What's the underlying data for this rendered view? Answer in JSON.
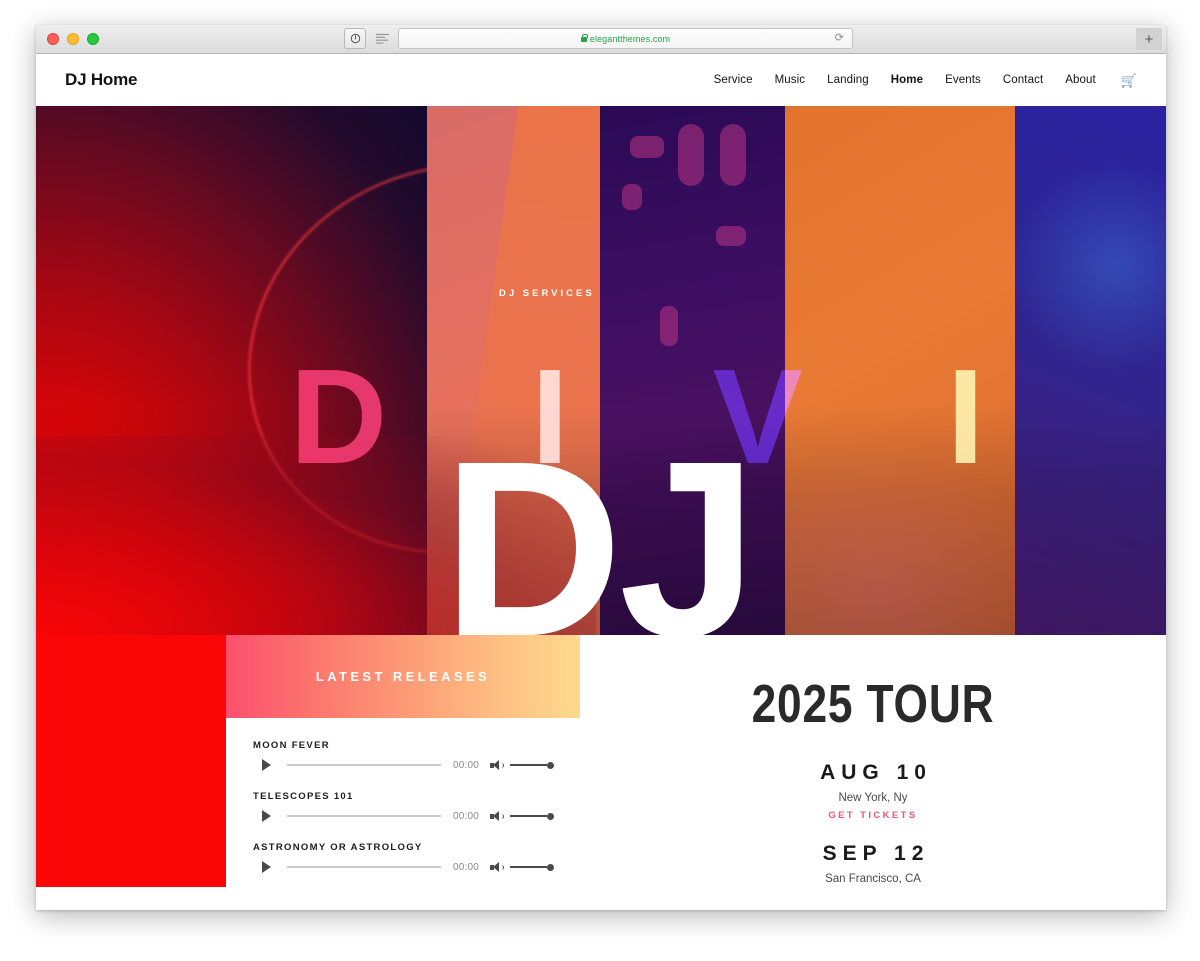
{
  "browser": {
    "url": "elegantthemes.com",
    "secure_icon": "lock-icon",
    "reload_icon": "reload-icon",
    "new_tab_label": "+",
    "reader_icon": "reader-icon",
    "shield_icon": "shield-icon"
  },
  "header": {
    "logo": "DJ Home",
    "nav": [
      {
        "label": "Service",
        "active": false
      },
      {
        "label": "Music",
        "active": false
      },
      {
        "label": "Landing",
        "active": false
      },
      {
        "label": "Home",
        "active": true
      },
      {
        "label": "Events",
        "active": false
      },
      {
        "label": "Contact",
        "active": false
      },
      {
        "label": "About",
        "active": false
      }
    ],
    "cart_icon": "shopping-cart-icon"
  },
  "hero": {
    "eyebrow": "DJ SERVICES",
    "background_letters": [
      "D",
      "I",
      "V",
      "I"
    ],
    "letter_colors": [
      "#e8345f",
      "#ffc9cf",
      "#2f1fb5",
      "#ffe49a"
    ],
    "headline": "DJ",
    "column_colors": [
      "#c5071b",
      "#e06d5b",
      "#3a0e5e",
      "#e2742f",
      "#2e2593"
    ]
  },
  "releases": {
    "heading": "LATEST RELEASES",
    "gradient_from": "#fb4f6e",
    "gradient_to": "#ffda8e",
    "tracks": [
      {
        "title": "MOON FEVER",
        "time": "00:00",
        "play_icon": "play-icon",
        "volume_icon": "volume-icon"
      },
      {
        "title": "TELESCOPES 101",
        "time": "00:00",
        "play_icon": "play-icon",
        "volume_icon": "volume-icon"
      },
      {
        "title": "ASTRONOMY OR ASTROLOGY",
        "time": "00:00",
        "play_icon": "play-icon",
        "volume_icon": "volume-icon"
      }
    ]
  },
  "tour": {
    "title": "2025 TOUR",
    "link_color": "#e8547f",
    "dates": [
      {
        "date": "AUG 10",
        "city": "New York, Ny",
        "link": "GET TICKETS"
      },
      {
        "date": "SEP 12",
        "city": "San Francisco, CA",
        "link": ""
      }
    ]
  },
  "accent": {
    "red_block": "#fb0606"
  }
}
